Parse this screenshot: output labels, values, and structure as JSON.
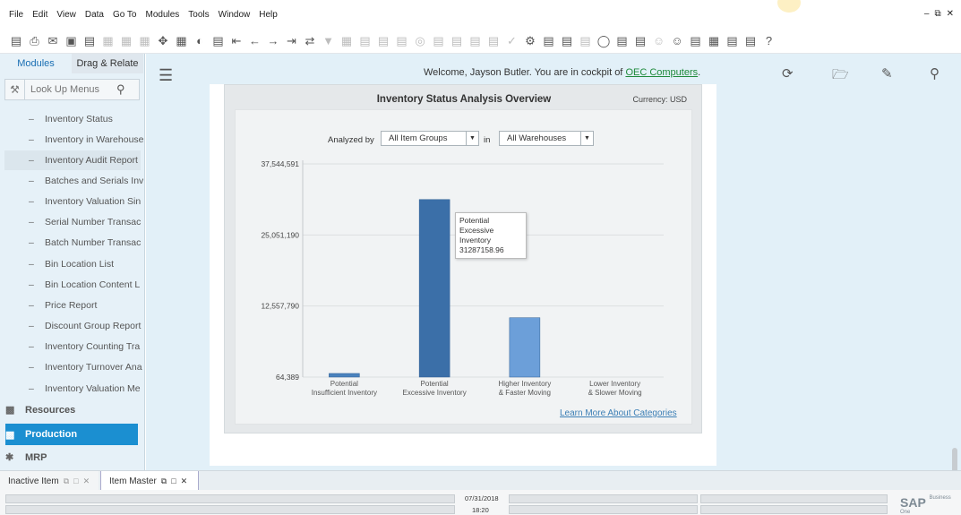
{
  "menubar": [
    "File",
    "Edit",
    "View",
    "Data",
    "Go To",
    "Modules",
    "Tools",
    "Window",
    "Help"
  ],
  "left_panel": {
    "tabs": [
      "Modules",
      "Drag & Relate"
    ],
    "lookup_placeholder": "Look Up Menus",
    "items": [
      "Inventory Status",
      "Inventory in Warehouse",
      "Inventory Audit Report",
      "Batches and Serials Inv",
      "Inventory Valuation Sin",
      "Serial Number Transac",
      "Batch Number Transac",
      "Bin Location List",
      "Bin Location Content L",
      "Price Report",
      "Discount Group Report",
      "Inventory Counting Tra",
      "Inventory Turnover Ana",
      "Inventory Valuation Me"
    ],
    "sections": [
      "Resources",
      "Production",
      "MRP"
    ]
  },
  "header": {
    "welcome": "Welcome, Jayson Butler. You are in cockpit of",
    "company": "OEC Computers",
    "company_suffix": "."
  },
  "widget": {
    "title": "Inventory Status Analysis Overview",
    "currency_label": "Currency:",
    "currency": "USD",
    "analyzed_by_label": "Analyzed by",
    "item_groups": "All Item Groups",
    "in_label": "in",
    "warehouses": "All Warehouses",
    "learn_more": "Learn More About Categories"
  },
  "chart_data": {
    "type": "bar",
    "categories": [
      "Potential\nInsufficient Inventory",
      "Potential\nExcessive Inventory",
      "Higher Inventory\n& Faster Moving",
      "Lower Inventory\n& Slower Moving"
    ],
    "values": [
      700000,
      31287158.96,
      10500000,
      0
    ],
    "y_ticks": [
      "37,544,591",
      "25,051,190",
      "12,557,790",
      "64,389"
    ],
    "ylim": [
      64389,
      37544591
    ],
    "colors": [
      "#4a82bd",
      "#3b6fa8",
      "#6c9fd9",
      "#4a82bd"
    ],
    "tooltip": {
      "line1": "Potential",
      "line2": "Excessive Inventory",
      "line3": "31287158.96"
    },
    "grid": true
  },
  "bottom_tabs": [
    "Inactive Item",
    "Item Master"
  ],
  "status": {
    "date": "07/31/2018",
    "time": "18:20",
    "brand": "SAP",
    "brand_sub": "Business One"
  }
}
